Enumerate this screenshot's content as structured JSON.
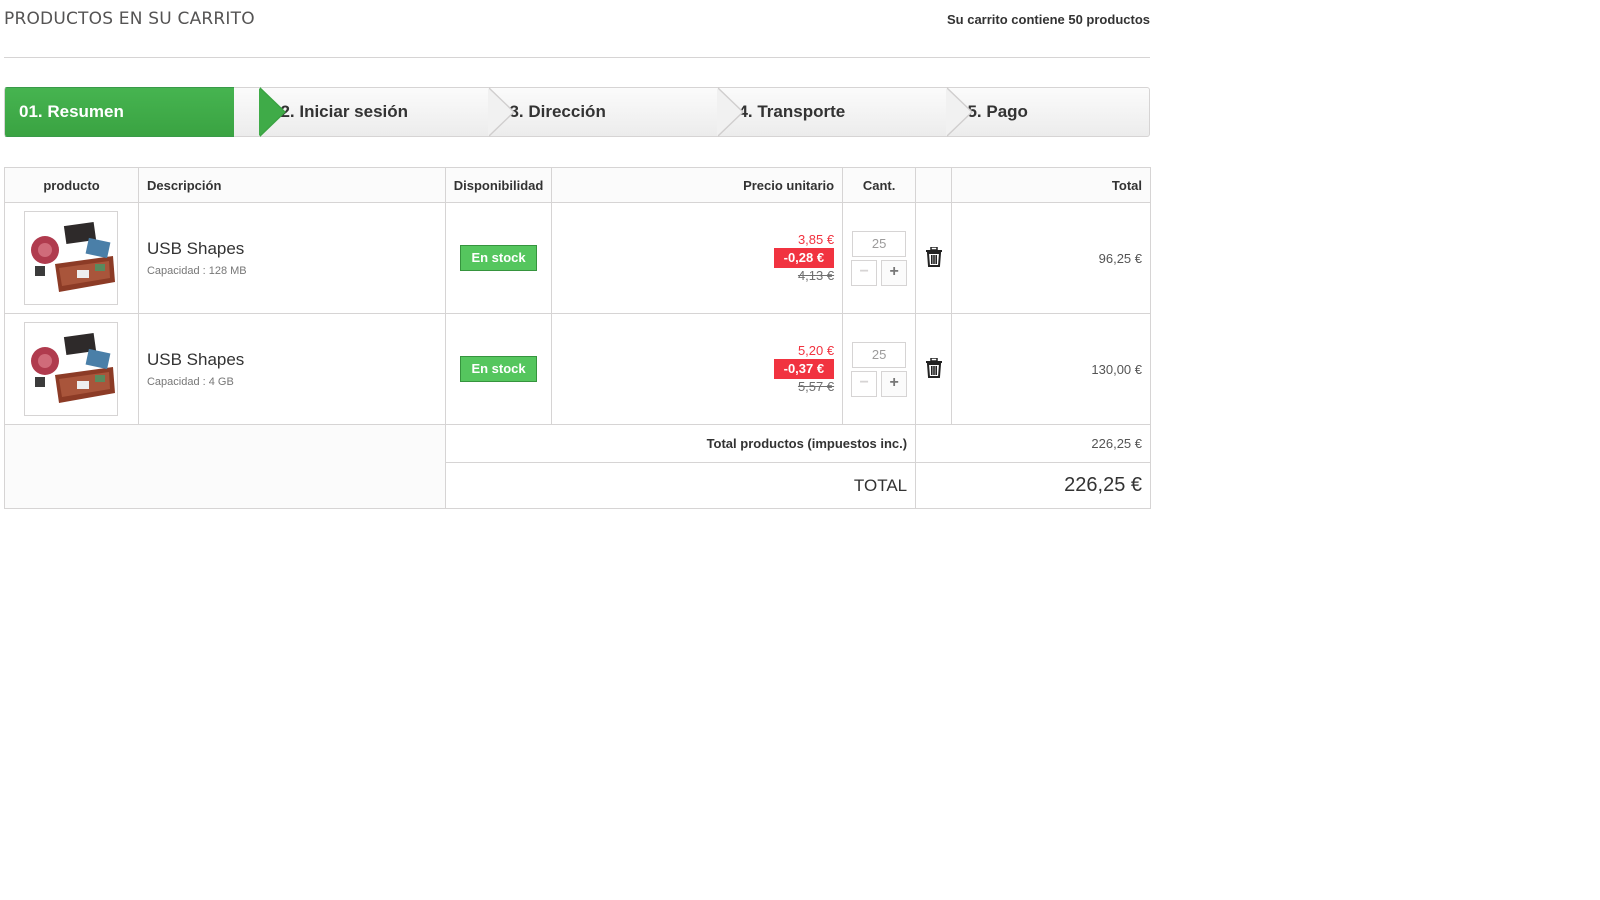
{
  "header": {
    "title": "PRODUCTOS EN SU CARRITO",
    "cart_count": "Su carrito contiene 50 productos"
  },
  "steps": [
    {
      "label": "01. Resumen",
      "active": true
    },
    {
      "label": "02. Iniciar sesión",
      "active": false
    },
    {
      "label": "03. Dirección",
      "active": false
    },
    {
      "label": "04. Transporte",
      "active": false
    },
    {
      "label": "05. Pago",
      "active": false
    }
  ],
  "table": {
    "columns": {
      "product": "producto",
      "description": "Descripción",
      "availability": "Disponibilidad",
      "unit_price": "Precio unitario",
      "qty": "Cant.",
      "total": "Total"
    },
    "items": [
      {
        "name": "USB Shapes",
        "attribute": "Capacidad : 128 MB",
        "availability": "En stock",
        "price": "3,85 €",
        "reduction": "-0,28 €",
        "old_price": "4,13 €",
        "qty": "25",
        "total": "96,25 €"
      },
      {
        "name": "USB Shapes",
        "attribute": "Capacidad : 4 GB",
        "availability": "En stock",
        "price": "5,20 €",
        "reduction": "-0,37 €",
        "old_price": "5,57 €",
        "qty": "25",
        "total": "130,00 €"
      }
    ],
    "summary": {
      "products_label": "Total productos (impuestos inc.)",
      "products_value": "226,25 €",
      "total_label": "TOTAL",
      "total_value": "226,25 €"
    }
  },
  "icons": {
    "trash": "trash-icon",
    "minus": "minus-icon",
    "plus": "plus-icon",
    "product_image": "product-thumbnail"
  },
  "colors": {
    "active_step": "#46b450",
    "in_stock": "#55c65e",
    "price_red": "#f13340"
  }
}
